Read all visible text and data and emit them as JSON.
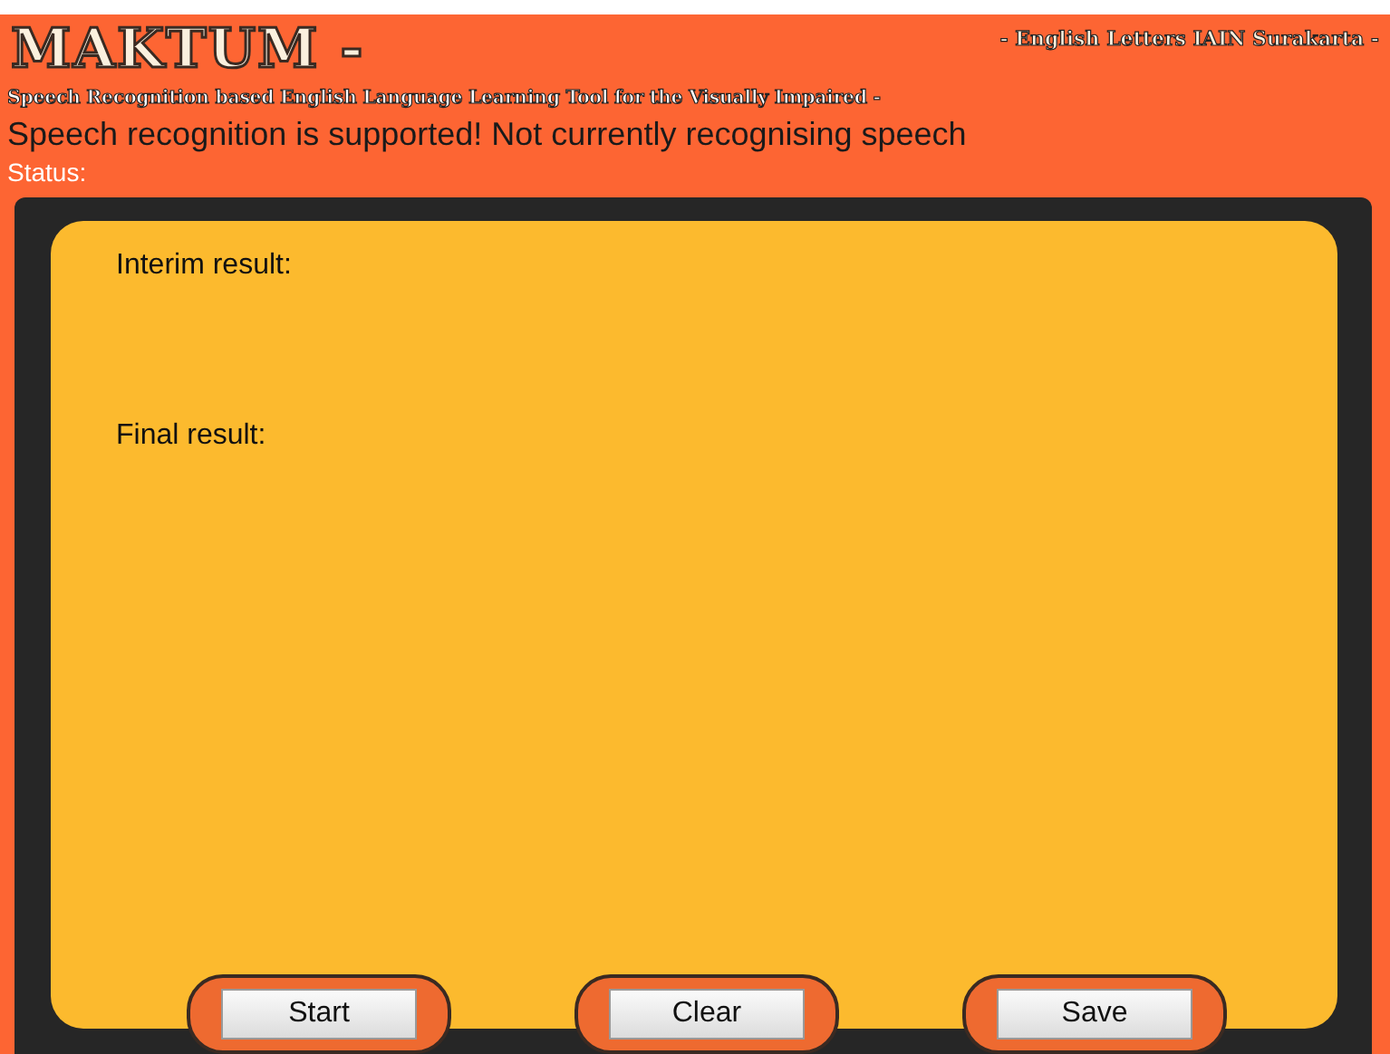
{
  "header": {
    "title": "MAKTUM -",
    "affiliation": "- English Letters IAIN Surakarta -",
    "subtitle": "Speech Recognition based English Language Learning Tool for the Visually Impaired -"
  },
  "support_message": "Speech recognition is supported! Not currently recognising speech",
  "status_label": "Status:",
  "results": [
    {
      "label": "Interim result:"
    },
    {
      "label": "Final result:"
    }
  ],
  "buttons": [
    "Start",
    "Clear",
    "Save"
  ]
}
